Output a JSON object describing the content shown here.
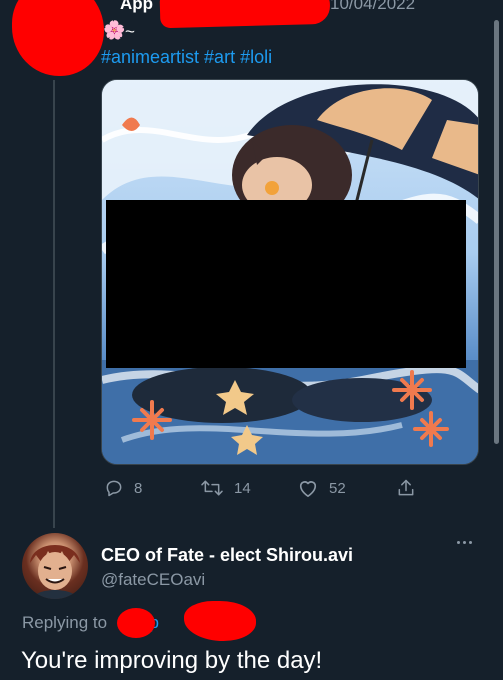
{
  "tweet": {
    "author_partial": "App",
    "date_partial": "10/04/2022",
    "emoji": "🌸",
    "text_suffix": "~",
    "hashtags": [
      "#animeartist",
      "#art",
      "#loli"
    ],
    "media_alt": "anime illustration, partially censored",
    "actions": {
      "reply_count": "8",
      "retweet_count": "14",
      "like_count": "52"
    }
  },
  "reply": {
    "display_name": "CEO of Fate - elect Shirou.avi",
    "handle": "@fateCEOavi",
    "replying_to_label": "Replying to",
    "replying_to_user": "pp",
    "text": "You're improving by the day!"
  },
  "colors": {
    "background": "#15202b",
    "link": "#1d9bf0",
    "secondary_text": "#8b98a5",
    "redaction": "#ff0000",
    "censor_box": "#000000"
  },
  "icons": [
    "reply-icon",
    "retweet-icon",
    "like-icon",
    "share-icon",
    "more-icon"
  ]
}
